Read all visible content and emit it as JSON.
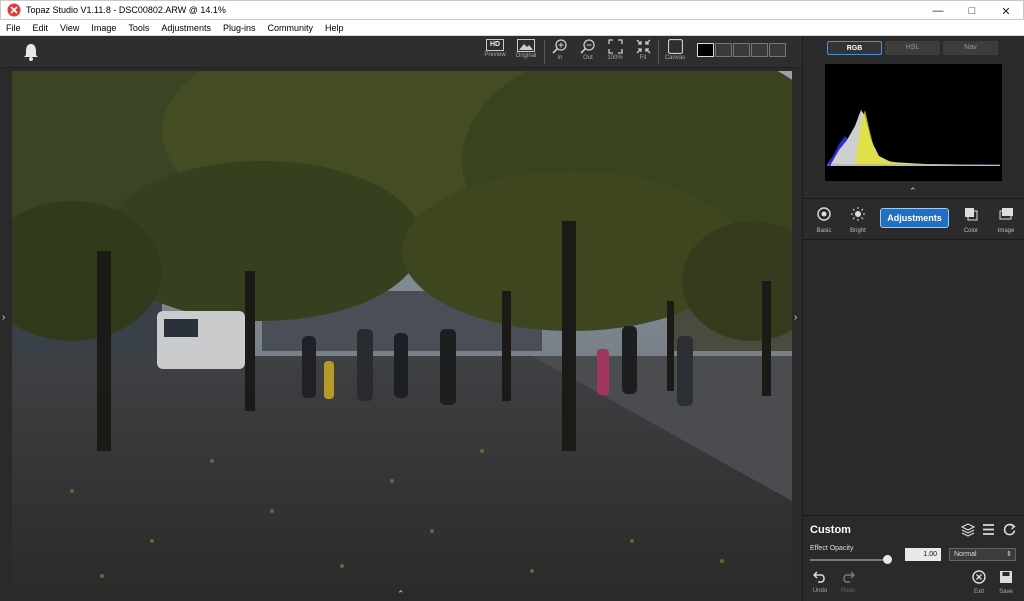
{
  "window": {
    "title": "Topaz Studio V1.11.8 - DSC00802.ARW @ 14.1%"
  },
  "menu": [
    "File",
    "Edit",
    "View",
    "Image",
    "Tools",
    "Adjustments",
    "Plug-ins",
    "Community",
    "Help"
  ],
  "toolbar": {
    "preview_label": "Preview",
    "original_label": "Original",
    "in_label": "In",
    "out_label": "Out",
    "zoom100_label": "100%",
    "fit_label": "Fit",
    "canvas_label": "Canvas",
    "hd_badge": "HD"
  },
  "histogram": {
    "tabs": [
      "RGB",
      "HSL",
      "Nav"
    ],
    "active_tab": "RGB"
  },
  "categories": {
    "basic": "Basic",
    "bright": "Bright",
    "adjustments": "Adjustments",
    "color": "Color",
    "image": "Image"
  },
  "preset": {
    "name": "Custom",
    "effect_opacity_label": "Effect Opacity",
    "effect_opacity_value": "1.00",
    "opacity_fraction": 1.0,
    "blend_mode": "Normal"
  },
  "actions": {
    "undo": "Undo",
    "redo": "Redo",
    "exit": "Exit",
    "save": "Save"
  },
  "colors": {
    "accent": "#1f6fc4",
    "panel": "#2b2b2b"
  }
}
